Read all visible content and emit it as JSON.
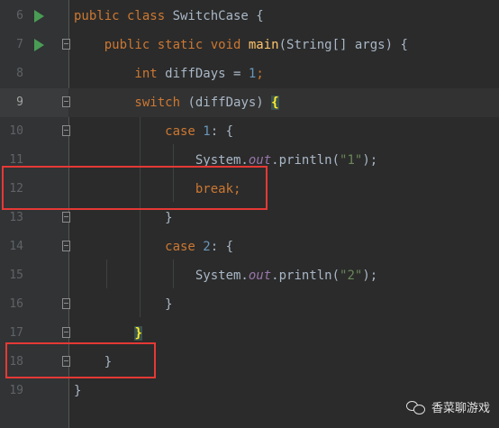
{
  "editor": {
    "lines": [
      {
        "number": "6",
        "tokens": [
          {
            "text": "public class ",
            "cls": "kw"
          },
          {
            "text": "SwitchCase {",
            "cls": ""
          }
        ]
      },
      {
        "number": "7",
        "tokens": [
          {
            "text": "    public static void ",
            "cls": "kw"
          },
          {
            "text": "main",
            "cls": "fn"
          },
          {
            "text": "(String[] args) {",
            "cls": ""
          }
        ]
      },
      {
        "number": "8",
        "tokens": [
          {
            "text": "        int ",
            "cls": "kw"
          },
          {
            "text": "diffDays = ",
            "cls": ""
          },
          {
            "text": "1",
            "cls": "num"
          },
          {
            "text": ";",
            "cls": "kw"
          }
        ]
      },
      {
        "number": "9",
        "tokens": [
          {
            "text": "        switch ",
            "cls": "kw"
          },
          {
            "text": "(diffDays) ",
            "cls": ""
          },
          {
            "text": "{",
            "cls": "brace-hl"
          }
        ]
      },
      {
        "number": "10",
        "tokens": [
          {
            "text": "            case ",
            "cls": "kw"
          },
          {
            "text": "1",
            "cls": "num"
          },
          {
            "text": ": {",
            "cls": ""
          }
        ]
      },
      {
        "number": "11",
        "tokens": [
          {
            "text": "                System.",
            "cls": ""
          },
          {
            "text": "out",
            "cls": "field"
          },
          {
            "text": ".println(",
            "cls": ""
          },
          {
            "text": "\"1\"",
            "cls": "str"
          },
          {
            "text": ");",
            "cls": ""
          }
        ]
      },
      {
        "number": "12",
        "tokens": [
          {
            "text": "                break",
            "cls": "kw"
          },
          {
            "text": ";",
            "cls": "kw"
          }
        ]
      },
      {
        "number": "13",
        "tokens": [
          {
            "text": "            }",
            "cls": ""
          }
        ]
      },
      {
        "number": "14",
        "tokens": [
          {
            "text": "            case ",
            "cls": "kw"
          },
          {
            "text": "2",
            "cls": "num"
          },
          {
            "text": ": {",
            "cls": ""
          }
        ]
      },
      {
        "number": "15",
        "tokens": [
          {
            "text": "                System.",
            "cls": ""
          },
          {
            "text": "out",
            "cls": "field"
          },
          {
            "text": ".println(",
            "cls": ""
          },
          {
            "text": "\"2\"",
            "cls": "str"
          },
          {
            "text": ");",
            "cls": ""
          }
        ]
      },
      {
        "number": "16",
        "tokens": [
          {
            "text": "            }",
            "cls": ""
          }
        ]
      },
      {
        "number": "17",
        "tokens": [
          {
            "text": "        ",
            "cls": ""
          },
          {
            "text": "}",
            "cls": "brace-hl"
          }
        ]
      },
      {
        "number": "18",
        "tokens": [
          {
            "text": "    }",
            "cls": ""
          }
        ]
      },
      {
        "number": "19",
        "tokens": [
          {
            "text": "}",
            "cls": ""
          }
        ]
      }
    ]
  },
  "watermark": {
    "text": "香菜聊游戏",
    "icon": "wechat-icon"
  },
  "colors": {
    "background": "#2b2b2b",
    "gutter": "#313335",
    "keyword": "#cc7832",
    "method": "#ffc66d",
    "number": "#6897bb",
    "string": "#6a8759",
    "field": "#9876aa",
    "annotation_box": "#e53935"
  }
}
